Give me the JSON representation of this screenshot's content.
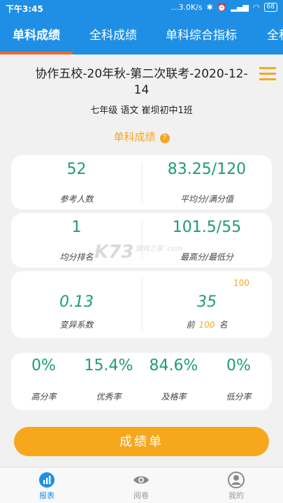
{
  "status_bar": {
    "time": "下午3:45",
    "network_speed": "...3.0K/s",
    "battery": "68"
  },
  "tabs": [
    {
      "label": "单科成绩",
      "active": true
    },
    {
      "label": "全科成绩",
      "active": false
    },
    {
      "label": "单科综合指标",
      "active": false
    },
    {
      "label": "全科",
      "active": false
    }
  ],
  "header": {
    "exam_title": "协作五校-20年秋-第二次联考-2020-12-14",
    "subtitle": "七年级 语文 崔坝初中1班",
    "section_title": "单科成绩",
    "help_glyph": "?"
  },
  "stats": {
    "participants": {
      "value": "52",
      "label": "参考人数"
    },
    "avg_full": {
      "value": "83.25/120",
      "label": "平均分/满分值"
    },
    "avg_rank": {
      "value": "1",
      "label": "均分排名"
    },
    "max_min": {
      "value": "101.5/55",
      "label": "最高分/最低分"
    },
    "variation": {
      "value": "0.13",
      "label": "变异系数"
    },
    "top_rank": {
      "badge": "100",
      "value": "35",
      "label_prefix": "前",
      "label_num": "100",
      "label_suffix": "名"
    }
  },
  "rates": [
    {
      "value": "0%",
      "label": "高分率"
    },
    {
      "value": "15.4%",
      "label": "优秀率"
    },
    {
      "value": "84.6%",
      "label": "及格率"
    },
    {
      "value": "0%",
      "label": "低分率"
    }
  ],
  "watermark": {
    "text": "K73",
    "small": "游戏之家 .com"
  },
  "report_button": "成绩单",
  "bottom_nav": [
    {
      "label": "报表",
      "active": true,
      "icon": "chart-icon"
    },
    {
      "label": "阅卷",
      "active": false,
      "icon": "eye-icon"
    },
    {
      "label": "我的",
      "active": false,
      "icon": "user-icon"
    }
  ],
  "colors": {
    "primary": "#1f8fe6",
    "accent": "#f5a623",
    "value_green": "#1e9b78",
    "indicator": "#f0683a"
  }
}
